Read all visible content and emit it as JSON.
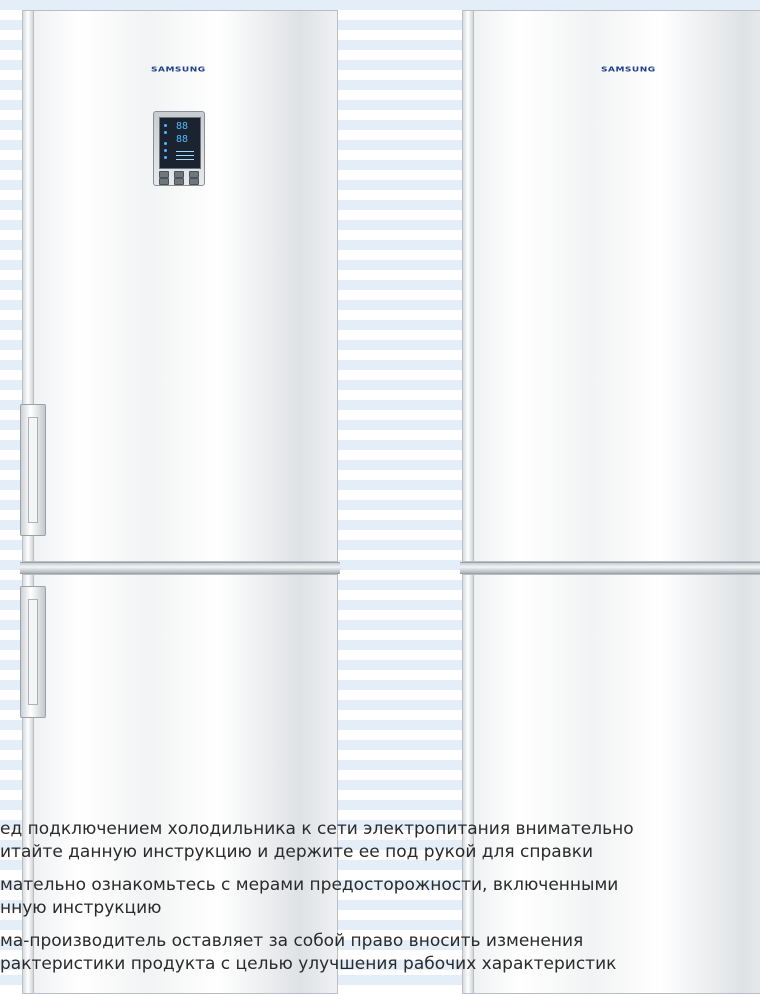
{
  "brand": {
    "left_logo": "SAMSUNG",
    "right_logo": "SAMSUNG"
  },
  "control_panel": {
    "display_value_top": "88",
    "display_value_bottom": "88"
  },
  "notes": [
    "ед подключением холодильника к сети электропитания внимательно",
    "итайте данную инструкцию и держите ее под рукой для справки",
    "мательно ознакомьтесь с мерами предосторожности, включенными",
    "нную инструкцию",
    "ма-производитель оставляет за собой право вносить изменения",
    "рактеристики продукта с целью улучшения рабочих характеристик"
  ]
}
